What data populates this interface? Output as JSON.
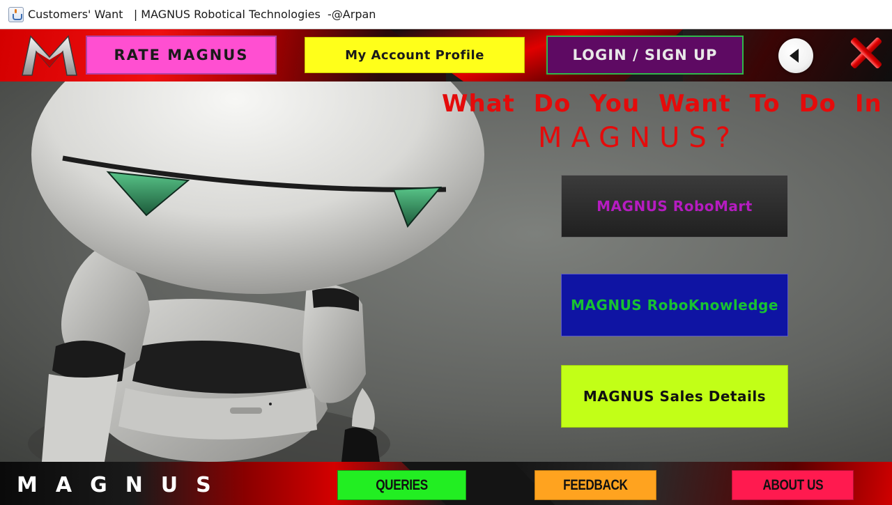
{
  "window": {
    "title": "Customers' Want   | MAGNUS Robotical Technologies  -@Arpan"
  },
  "header": {
    "rate_label": "RATE MAGNUS",
    "profile_label": "My Account Profile",
    "login_label": "LOGIN / SIGN UP"
  },
  "main": {
    "question_line1": "What Do You Want To Do In",
    "question_line2": "MAGNUS?",
    "options": [
      {
        "label": "MAGNUS RoboMart"
      },
      {
        "label": "MAGNUS RoboKnowledge"
      },
      {
        "label": "MAGNUS Sales Details"
      }
    ]
  },
  "footer": {
    "brand": "MAGNUS",
    "queries_label": "QUERIES",
    "feedback_label": "FEEDBACK",
    "about_label": "ABOUT US"
  },
  "icons": {
    "app": "java-cup-icon",
    "logo": "magnus-m-logo",
    "back": "back-arrow-icon",
    "close": "close-icon"
  },
  "colors": {
    "accent_red": "#e40b0b",
    "rate_pink": "#ff4fd1",
    "profile_yellow": "#ffff1a",
    "login_purple": "#5e0a63",
    "robomart_text": "#b51cc0",
    "knowledge_bg": "#0f14a3",
    "knowledge_text": "#18c232",
    "sales_bg": "#c2ff17",
    "queries_green": "#22ee22",
    "feedback_orange": "#ffa31f",
    "about_red": "#ff1a4f"
  }
}
